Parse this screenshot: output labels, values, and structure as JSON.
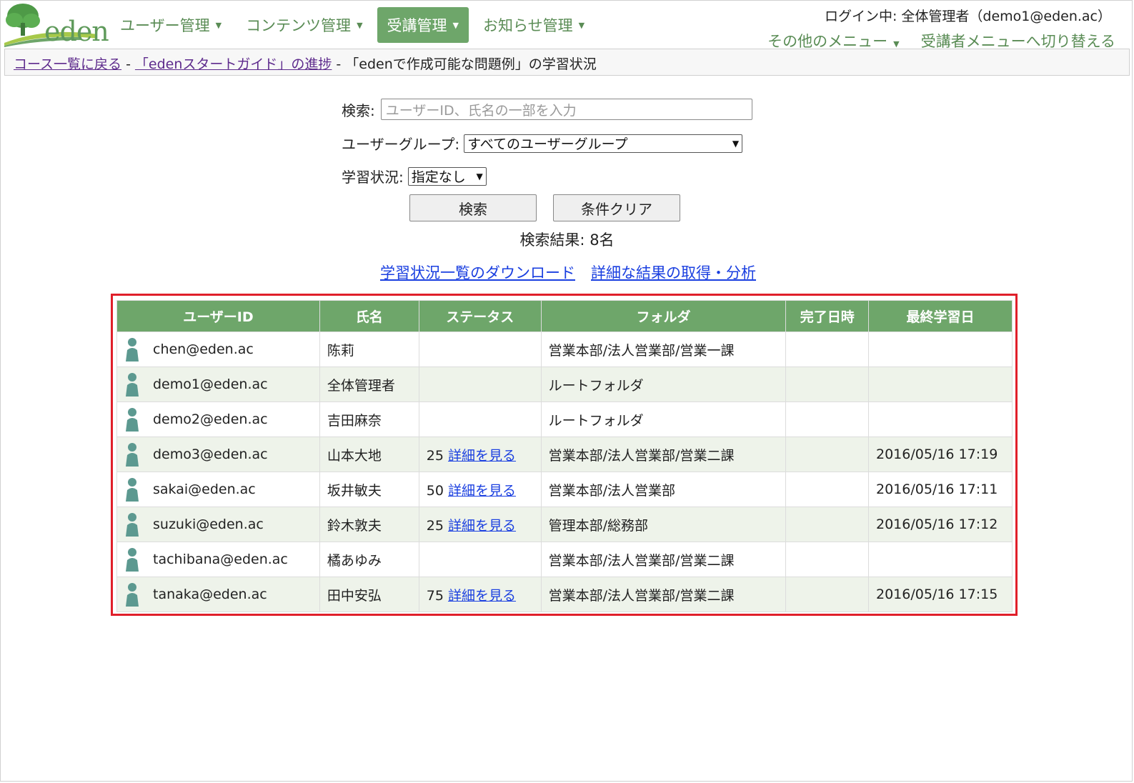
{
  "brand": {
    "logo_text": "eden",
    "logo_icon": "tree-logo-icon"
  },
  "nav": [
    {
      "label": "ユーザー管理",
      "active": false
    },
    {
      "label": "コンテンツ管理",
      "active": false
    },
    {
      "label": "受講管理",
      "active": true
    },
    {
      "label": "お知らせ管理",
      "active": false
    }
  ],
  "login_text": "ログイン中: 全体管理者（demo1@eden.ac）",
  "submenu": {
    "other": "その他のメニュー",
    "switch": "受講者メニューへ切り替える"
  },
  "breadcrumb": {
    "back": "コース一覧に戻る",
    "sep": "-",
    "progress": "「edenスタートガイド」の進捗",
    "current": "「edenで作成可能な問題例」の学習状況"
  },
  "search": {
    "label": "検索:",
    "placeholder": "ユーザーID、氏名の一部を入力",
    "group_label": "ユーザーグループ:",
    "group_value": "すべてのユーザーグループ",
    "status_label": "学習状況:",
    "status_value": "指定なし",
    "search_button": "検索",
    "clear_button": "条件クリア",
    "result": "検索結果: 8名"
  },
  "links": {
    "download": "学習状況一覧のダウンロード",
    "analysis": "詳細な結果の取得・分析"
  },
  "table": {
    "headers": [
      "ユーザーID",
      "氏名",
      "ステータス",
      "フォルダ",
      "完了日時",
      "最終学習日"
    ],
    "rows": [
      {
        "id": "chen@eden.ac",
        "name": "陈莉",
        "score": "",
        "detail": "",
        "folder": "営業本部/法人営業部/営業一課",
        "done": "",
        "last": ""
      },
      {
        "id": "demo1@eden.ac",
        "name": "全体管理者",
        "score": "",
        "detail": "",
        "folder": "ルートフォルダ",
        "done": "",
        "last": ""
      },
      {
        "id": "demo2@eden.ac",
        "name": "吉田麻奈",
        "score": "",
        "detail": "",
        "folder": "ルートフォルダ",
        "done": "",
        "last": ""
      },
      {
        "id": "demo3@eden.ac",
        "name": "山本大地",
        "score": "25",
        "detail": "詳細を見る",
        "folder": "営業本部/法人営業部/営業二課",
        "done": "",
        "last": "2016/05/16 17:19"
      },
      {
        "id": "sakai@eden.ac",
        "name": "坂井敏夫",
        "score": "50",
        "detail": "詳細を見る",
        "folder": "営業本部/法人営業部",
        "done": "",
        "last": "2016/05/16 17:11"
      },
      {
        "id": "suzuki@eden.ac",
        "name": "鈴木敦夫",
        "score": "25",
        "detail": "詳細を見る",
        "folder": "管理本部/総務部",
        "done": "",
        "last": "2016/05/16 17:12"
      },
      {
        "id": "tachibana@eden.ac",
        "name": "橘あゆみ",
        "score": "",
        "detail": "",
        "folder": "営業本部/法人営業部/営業二課",
        "done": "",
        "last": ""
      },
      {
        "id": "tanaka@eden.ac",
        "name": "田中安弘",
        "score": "75",
        "detail": "詳細を見る",
        "folder": "営業本部/法人営業部/営業二課",
        "done": "",
        "last": "2016/05/16 17:15"
      }
    ]
  },
  "colors": {
    "accent": "#6ea66a",
    "highlight_box": "#e01f2a",
    "link": "#1a3fe0",
    "person_icon": "#5c9990"
  }
}
